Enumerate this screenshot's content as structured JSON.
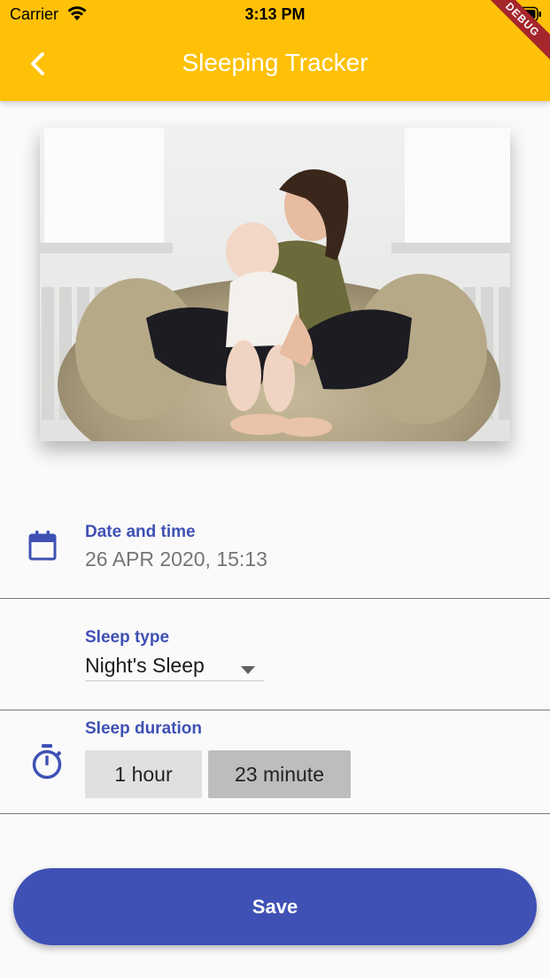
{
  "status_bar": {
    "carrier": "Carrier",
    "time": "3:13 PM"
  },
  "debug_banner": "DEBUG",
  "app_bar": {
    "title": "Sleeping Tracker",
    "back_icon": "chevron-left-icon",
    "background": "#fec107"
  },
  "fields": {
    "date_time": {
      "icon": "calendar-icon",
      "label": "Date and time",
      "value": "26 APR 2020, 15:13"
    },
    "sleep_type": {
      "icon": "moon-icon",
      "label": "Sleep type",
      "selected": "Night's Sleep"
    },
    "sleep_duration": {
      "icon": "timer-icon",
      "label": "Sleep duration",
      "hours": "1 hour",
      "minutes": "23 minute"
    }
  },
  "save_button": {
    "label": "Save"
  },
  "colors": {
    "accent": "#3f51b5",
    "app_bar": "#fec107"
  }
}
